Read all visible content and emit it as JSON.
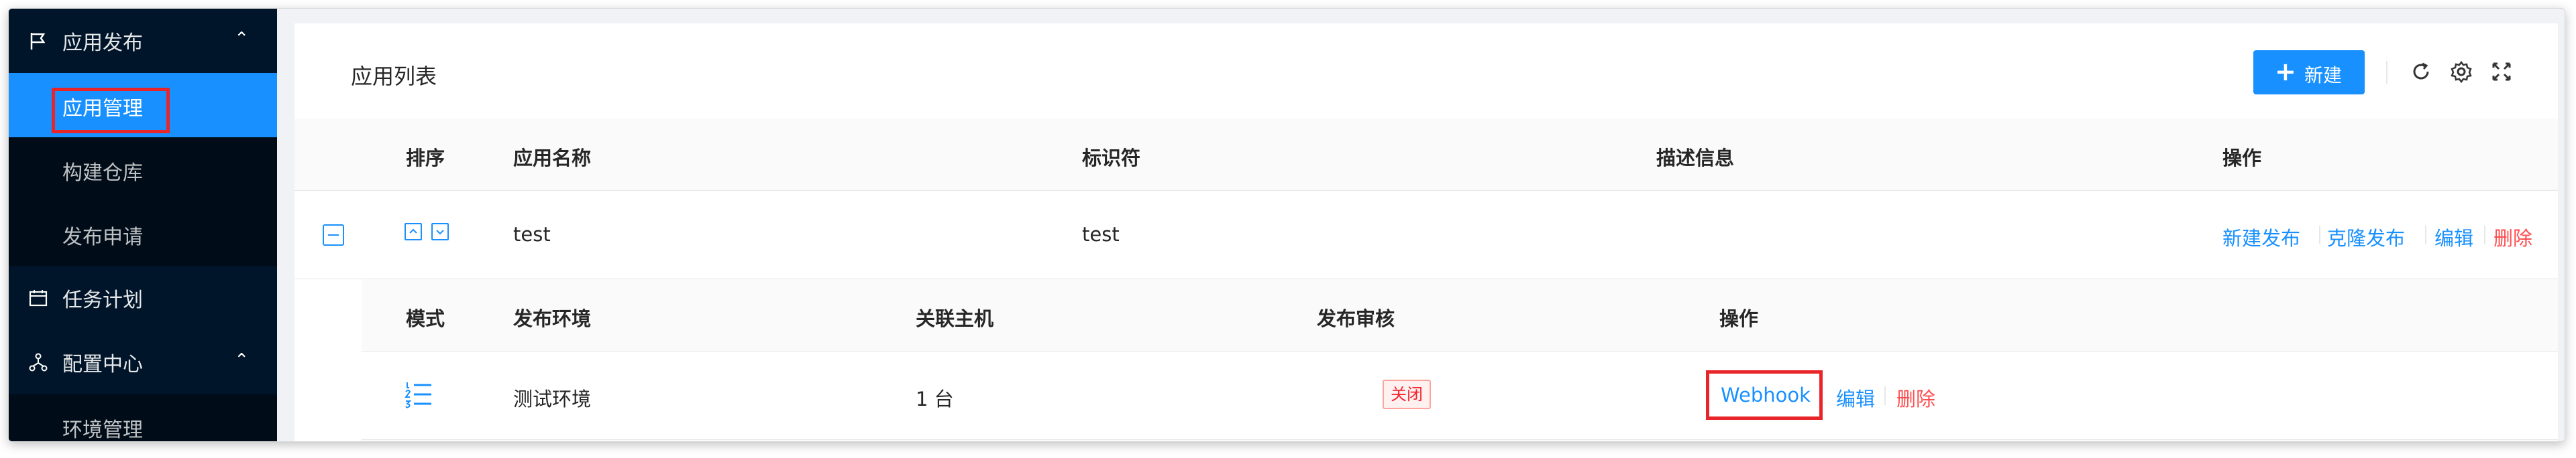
{
  "sidebar": {
    "group_release": {
      "label": "应用发布",
      "icon": "flag-icon"
    },
    "items": [
      {
        "label": "应用管理",
        "active": true
      },
      {
        "label": "构建仓库"
      },
      {
        "label": "发布申请"
      }
    ],
    "task_plan": {
      "label": "任务计划",
      "icon": "schedule-icon"
    },
    "group_config": {
      "label": "配置中心",
      "icon": "cluster-icon"
    },
    "config_items": [
      {
        "label": "环境管理"
      }
    ]
  },
  "card": {
    "title": "应用列表",
    "new_button": "新建",
    "toolbar_icons": [
      "reload-icon",
      "setting-icon",
      "fullscreen-icon"
    ]
  },
  "table": {
    "columns": [
      "排序",
      "应用名称",
      "标识符",
      "描述信息",
      "操作"
    ],
    "rows": [
      {
        "name": "test",
        "identifier": "test",
        "description": "",
        "actions": [
          "新建发布",
          "克隆发布",
          "编辑",
          "删除"
        ]
      }
    ]
  },
  "subtable": {
    "columns": [
      "模式",
      "发布环境",
      "关联主机",
      "发布审核",
      "操作"
    ],
    "rows": [
      {
        "mode_icon": "list-ordered-icon",
        "env": "测试环境",
        "hosts": "1 台",
        "review": "关闭",
        "actions": [
          "Webhook",
          "编辑",
          "删除"
        ]
      }
    ]
  },
  "colors": {
    "primary": "#1890ff",
    "danger": "#ff4d4f",
    "sidebar_bg": "#001529",
    "highlight": "#e8262a"
  }
}
